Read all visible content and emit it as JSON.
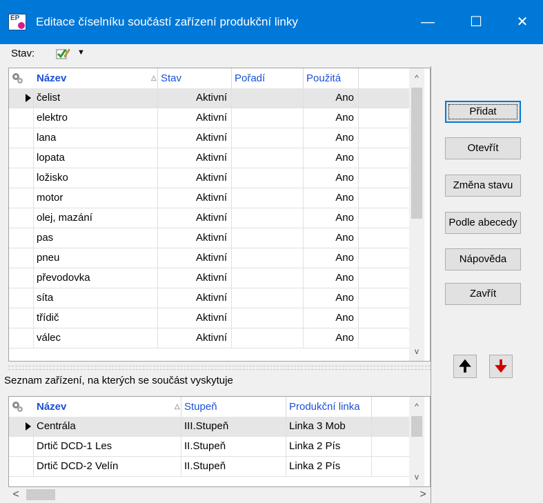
{
  "window": {
    "title": "Editace číselníku součástí zařízení produkční linky",
    "minimize_glyph": "—",
    "maximize_glyph": "☐",
    "close_glyph": "✕",
    "title_bar_color": "#0078d7"
  },
  "toolbar": {
    "status_label": "Stav:",
    "status_icon": "checkmark-pencil-icon",
    "dropdown_glyph": "▼"
  },
  "parts_grid": {
    "columns": [
      "Název",
      "Stav",
      "Pořadí",
      "Použitá"
    ],
    "sort_glyph": "△",
    "rows": [
      {
        "name": "čelist",
        "status": "Aktivní",
        "order": "",
        "used": "Ano",
        "selected": true
      },
      {
        "name": "elektro",
        "status": "Aktivní",
        "order": "",
        "used": "Ano"
      },
      {
        "name": "lana",
        "status": "Aktivní",
        "order": "",
        "used": "Ano"
      },
      {
        "name": "lopata",
        "status": "Aktivní",
        "order": "",
        "used": "Ano"
      },
      {
        "name": "ložisko",
        "status": "Aktivní",
        "order": "",
        "used": "Ano"
      },
      {
        "name": "motor",
        "status": "Aktivní",
        "order": "",
        "used": "Ano"
      },
      {
        "name": "olej, mazání",
        "status": "Aktivní",
        "order": "",
        "used": "Ano"
      },
      {
        "name": "pas",
        "status": "Aktivní",
        "order": "",
        "used": "Ano"
      },
      {
        "name": "pneu",
        "status": "Aktivní",
        "order": "",
        "used": "Ano"
      },
      {
        "name": "převodovka",
        "status": "Aktivní",
        "order": "",
        "used": "Ano"
      },
      {
        "name": "síta",
        "status": "Aktivní",
        "order": "",
        "used": "Ano"
      },
      {
        "name": "třídič",
        "status": "Aktivní",
        "order": "",
        "used": "Ano"
      },
      {
        "name": "válec",
        "status": "Aktivní",
        "order": "",
        "used": "Ano"
      }
    ]
  },
  "equipment_list": {
    "caption": "Seznam zařízení, na kterých se součást vyskytuje",
    "columns": [
      "Název",
      "Stupeň",
      "Produkční linka"
    ],
    "sort_glyph": "△",
    "rows": [
      {
        "name": "Centrála",
        "level": "III.Stupeň",
        "line": "Linka 3 Mob",
        "selected": true
      },
      {
        "name": "Drtič DCD-1 Les",
        "level": "II.Stupeň",
        "line": "Linka 2 Pís"
      },
      {
        "name": "Drtič DCD-2 Velín",
        "level": "II.Stupeň",
        "line": "Linka 2 Pís"
      }
    ]
  },
  "buttons": {
    "add": "Přidat",
    "open": "Otevřít",
    "change_status": "Změna stavu",
    "alphabetical": "Podle abecedy",
    "help": "Nápověda",
    "close": "Zavřít"
  },
  "move_buttons": {
    "up_glyph": "🠉",
    "down_glyph": "🠋",
    "down_color": "#d00000"
  },
  "scroll": {
    "up_glyph": "^",
    "down_glyph": "v",
    "left_glyph": "<",
    "right_glyph": ">"
  }
}
